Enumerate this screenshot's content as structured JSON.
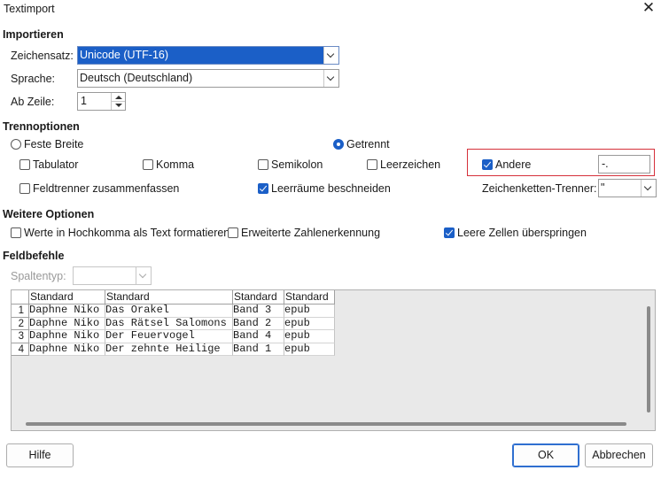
{
  "window": {
    "title": "Textimport"
  },
  "importieren": {
    "heading": "Importieren",
    "zeichensatz_label": "Zeichensatz:",
    "zeichensatz_value": "Unicode (UTF-16)",
    "sprache_label": "Sprache:",
    "sprache_value": "Deutsch (Deutschland)",
    "ab_zeile_label": "Ab Zeile:",
    "ab_zeile_value": "1"
  },
  "trennoptionen": {
    "heading": "Trennoptionen",
    "feste_breite": "Feste Breite",
    "getrennt": "Getrennt",
    "tabulator": "Tabulator",
    "komma": "Komma",
    "semikolon": "Semikolon",
    "leerzeichen": "Leerzeichen",
    "andere": "Andere",
    "andere_value": "-.",
    "feldtrenner": "Feldtrenner zusammenfassen",
    "leerraeume": "Leerräume beschneiden",
    "zeichenketten_label": "Zeichenketten-Trenner:",
    "zeichenketten_value": "\""
  },
  "weitere": {
    "heading": "Weitere Optionen",
    "hochkomma": "Werte in Hochkomma als Text formatieren",
    "zahlen": "Erweiterte Zahlenerkennung",
    "leere_zellen": "Leere Zellen überspringen"
  },
  "feldbefehle": {
    "heading": "Feldbefehle",
    "spaltentyp_label": "Spaltentyp:",
    "spaltentyp_value": ""
  },
  "preview": {
    "headers": [
      "Standard",
      "Standard",
      "Standard",
      "Standard"
    ],
    "rows": [
      {
        "num": "1",
        "cells": [
          "Daphne Niko",
          "Das Orakel",
          "Band 3",
          "epub"
        ]
      },
      {
        "num": "2",
        "cells": [
          "Daphne Niko",
          "Das Rätsel Salomons",
          "Band 2",
          "epub"
        ]
      },
      {
        "num": "3",
        "cells": [
          "Daphne Niko",
          "Der Feuervogel",
          "Band 4",
          "epub"
        ]
      },
      {
        "num": "4",
        "cells": [
          "Daphne Niko",
          "Der zehnte Heilige",
          "Band 1",
          "epub"
        ]
      }
    ]
  },
  "buttons": {
    "hilfe": "Hilfe",
    "ok": "OK",
    "abbrechen": "Abbrechen"
  },
  "icons": {
    "close": "close-icon",
    "dropdown": "chevron-down-icon"
  },
  "colors": {
    "accent": "#1b5fc7",
    "highlight_box": "#d6303a"
  }
}
